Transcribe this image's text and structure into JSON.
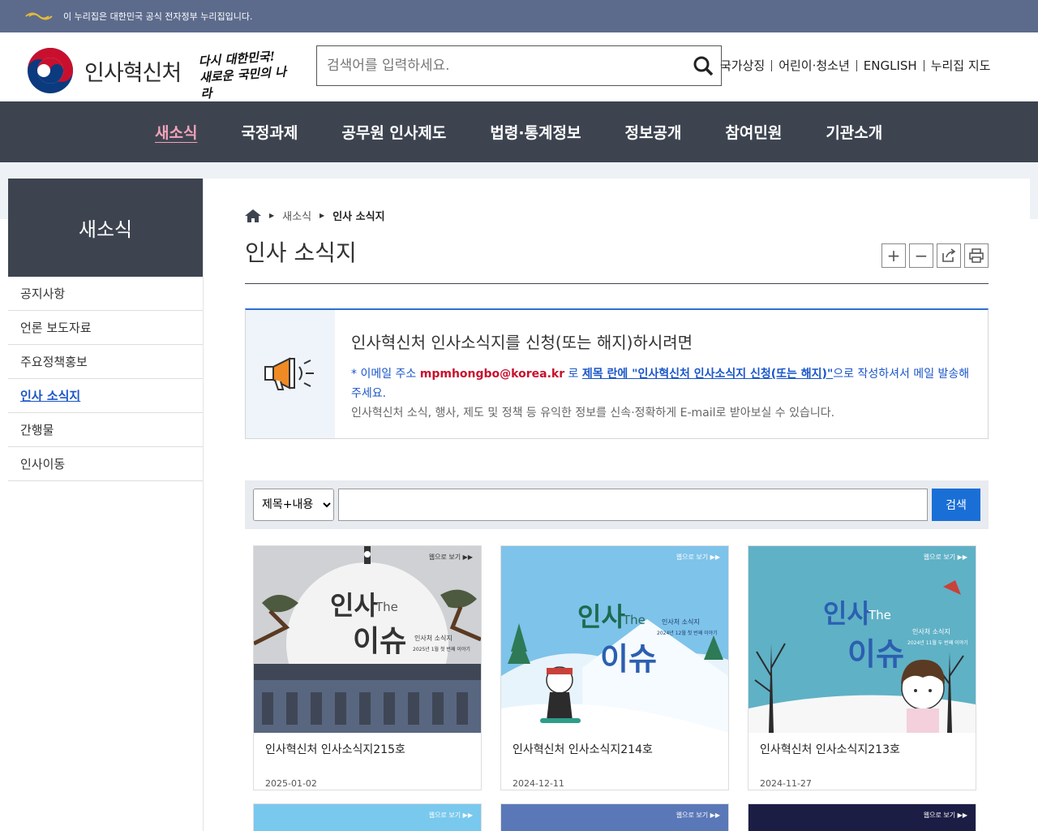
{
  "govbar": {
    "text": "이 누리집은 대한민국 공식 전자정부 누리집입니다."
  },
  "header": {
    "logo_text": "인사혁신처",
    "slogan_line1": "다시 대한민국!",
    "slogan_line2": "새로운 국민의 나라",
    "search_placeholder": "검색어를 입력하세요.",
    "util_links": [
      "국가상징",
      "어린이·청소년",
      "ENGLISH",
      "누리집 지도"
    ]
  },
  "gnb": {
    "items": [
      "새소식",
      "국정과제",
      "공무원 인사제도",
      "법령·통계정보",
      "정보공개",
      "참여민원",
      "기관소개"
    ]
  },
  "sidebar": {
    "title": "새소식",
    "items": [
      "공지사항",
      "언론 보도자료",
      "주요정책홍보",
      "인사 소식지",
      "간행물",
      "인사이동"
    ]
  },
  "breadcrumb": {
    "level1": "새소식",
    "level2": "인사 소식지"
  },
  "page_title": "인사 소식지",
  "notice": {
    "heading": "인사혁신처 인사소식지를 신청(또는 해지)하시려면",
    "l1_a": "* 이메일 주소 ",
    "l1_email": "mpmhongbo@korea.kr",
    "l1_b": " 로 ",
    "l1_subject": "제목 란에 \"인사혁신처 인사소식지 신청(또는 해지)\"",
    "l1_c": "으로 작성하셔서 메일 발송해 주세요.",
    "l2": "인사혁신처 소식, 행사, 제도 및 정책 등 유익한 정보를 신속·정확하게 E-mail로 받아보실 수 있습니다."
  },
  "search": {
    "select_value": "제목+내용",
    "button": "검색"
  },
  "cards": [
    {
      "title": "인사혁신처 인사소식지215호",
      "date": "2025-01-02",
      "issue": "2025년 1월 첫 번째 이야기"
    },
    {
      "title": "인사혁신처 인사소식지214호",
      "date": "2024-12-11",
      "issue": "2024년 12월 첫 번째 이야기"
    },
    {
      "title": "인사혁신처 인사소식지213호",
      "date": "2024-11-27",
      "issue": "2024년 11월 두 번째 이야기"
    }
  ],
  "thumb_text": {
    "big1": "인사",
    "the": "The",
    "big2": "이슈",
    "sub": "인사처 소식지",
    "more": "웹으로 보기 ▶▶"
  },
  "colors": {
    "gnb_bg": "#3d4450",
    "accent": "#1a6fd6",
    "active_menu": "#f3a3b8"
  }
}
